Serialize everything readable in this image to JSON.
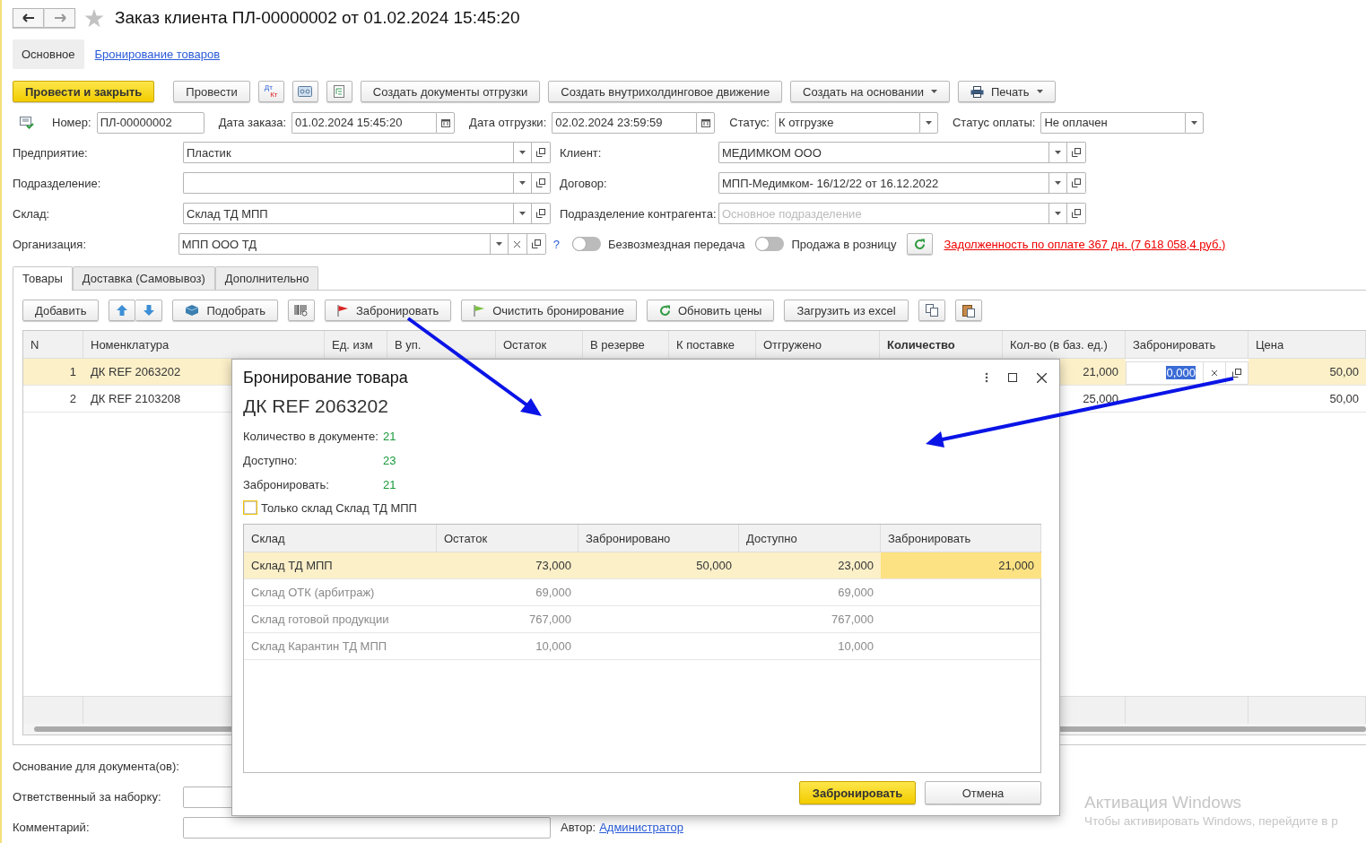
{
  "title": "Заказ клиента ПЛ-00000002 от 01.02.2024 15:45:20",
  "favorite": false,
  "sections": [
    {
      "label": "Основное",
      "selected": true
    },
    {
      "label": "Бронирование товаров",
      "selected": false
    }
  ],
  "commands": [
    {
      "kind": "primary",
      "label": "Провести и закрыть"
    },
    {
      "kind": "button",
      "label": "Провести"
    },
    {
      "kind": "dtkt",
      "top": "Дт",
      "bottom": "Кт"
    },
    {
      "kind": "cassette"
    },
    {
      "kind": "report"
    },
    {
      "kind": "button",
      "label": "Создать документы отгрузки"
    },
    {
      "kind": "button",
      "label": "Создать внутрихолдинговое движение"
    },
    {
      "kind": "menu",
      "label": "Создать на основании"
    },
    {
      "kind": "print",
      "label": "Печать"
    }
  ],
  "header_fields": [
    {
      "kind": "text",
      "label": "Номер:",
      "value": "ПЛ-00000002"
    },
    {
      "kind": "date",
      "label": "Дата заказа:",
      "value": "01.02.2024 15:45:20"
    },
    {
      "kind": "date",
      "label": "Дата отгрузки:",
      "value": "02.02.2024 23:59:59"
    },
    {
      "kind": "select",
      "label": "Статус:",
      "value": "К отгрузке"
    },
    {
      "kind": "select",
      "label": "Статус оплаты:",
      "value": "Не оплачен"
    }
  ],
  "left_fields": [
    {
      "kind": "ref",
      "label": "Предприятие:",
      "value": "Пластик"
    },
    {
      "kind": "ref",
      "label": "Подразделение:"
    },
    {
      "kind": "ref",
      "label": "Склад:",
      "value": "Склад ТД МПП"
    },
    {
      "kind": "clearable",
      "label": "Организация:",
      "value": "МПП ООО ТД"
    }
  ],
  "right_fields": [
    {
      "kind": "ref",
      "label": "Клиент:",
      "value": "МЕДИМКОМ ООО"
    },
    {
      "kind": "ref",
      "label": "Договор:",
      "value": "МПП-Медимком- 16/12/22 от 16.12.2022"
    },
    {
      "kind": "ref",
      "label": "Подразделение контрагента:",
      "placeholder": "Основное подразделение"
    }
  ],
  "help": "?",
  "toggles": [
    {
      "label": "Безвозмездная передача",
      "on": false
    },
    {
      "label": "Продажа в розницу",
      "on": false
    }
  ],
  "debt_link": "Задолженность по оплате 367 дн. (7 618 058,4 руб.)",
  "tabs": [
    {
      "label": "Товары",
      "selected": true
    },
    {
      "label": "Доставка (Самовывоз)",
      "selected": false
    },
    {
      "label": "Дополнительно",
      "selected": false
    }
  ],
  "table_toolbar": [
    {
      "kind": "button",
      "label": "Добавить"
    },
    {
      "kind": "updown"
    },
    {
      "kind": "pick",
      "label": "Подобрать"
    },
    {
      "kind": "barcode"
    },
    {
      "kind": "redflag",
      "label": "Забронировать"
    },
    {
      "kind": "greenflag",
      "label": "Очистить бронирование"
    },
    {
      "kind": "refresh",
      "label": "Обновить цены"
    },
    {
      "kind": "button",
      "label": "Загрузить из excel"
    },
    {
      "kind": "copy"
    },
    {
      "kind": "paste"
    }
  ],
  "table": {
    "columns": [
      {
        "label": "N",
        "emphasized": false
      },
      {
        "label": "Номенклатура",
        "emphasized": false
      },
      {
        "label": "Ед. изм",
        "emphasized": false
      },
      {
        "label": "В уп.",
        "emphasized": false
      },
      {
        "label": "Остаток",
        "emphasized": false
      },
      {
        "label": "В резерве",
        "emphasized": false
      },
      {
        "label": "К поставке",
        "emphasized": false
      },
      {
        "label": "Отгружено",
        "emphasized": false
      },
      {
        "label": "Количество",
        "emphasized": true
      },
      {
        "label": "Кол-во (в баз. ед.)",
        "emphasized": false
      },
      {
        "label": "Забронировать",
        "emphasized": false
      },
      {
        "label": "Цена",
        "emphasized": false
      }
    ],
    "rows": [
      {
        "n": "1",
        "name": "ДК REF 2063202",
        "qty_base": "21,000",
        "reserve": "0,000",
        "price": "50,00",
        "selected": true
      },
      {
        "n": "2",
        "name": "ДК REF 2103208",
        "qty_base": "25,000",
        "price": "50,00",
        "selected": false
      }
    ]
  },
  "bottom": {
    "basis": "Основание для документа(ов):",
    "picker": "Ответственный за наборку:",
    "comment": "Комментарий:",
    "author_label": "Автор:",
    "author": "Администратор"
  },
  "dialog": {
    "title": "Бронирование товара",
    "product": "ДК REF 2063202",
    "info": [
      {
        "label": "Количество в документе:",
        "value": "21"
      },
      {
        "label": "Доступно:",
        "value": "23"
      },
      {
        "label": "Забронировать:",
        "value": "21"
      }
    ],
    "only_warehouse": {
      "label": "Только склад Склад ТД МПП",
      "checked": false
    },
    "columns": [
      "Склад",
      "Остаток",
      "Забронировано",
      "Доступно",
      "Забронировать"
    ],
    "rows": [
      {
        "warehouse": "Склад ТД МПП",
        "stock": "73,000",
        "reserved": "50,000",
        "available": "23,000",
        "to_reserve": "21,000",
        "selected": true,
        "dimmed": false
      },
      {
        "warehouse": "Склад ОТК (арбитраж)",
        "stock": "69,000",
        "available": "69,000",
        "selected": false,
        "dimmed": true
      },
      {
        "warehouse": "Склад готовой продукции",
        "stock": "767,000",
        "available": "767,000",
        "selected": false,
        "dimmed": true
      },
      {
        "warehouse": "Склад Карантин ТД МПП",
        "stock": "10,000",
        "available": "10,000",
        "selected": false,
        "dimmed": true
      }
    ],
    "buttons": [
      {
        "kind": "primary",
        "label": "Забронировать"
      },
      {
        "kind": "default",
        "label": "Отмена"
      }
    ]
  },
  "activation": {
    "title": "Активация Windows",
    "text": "Чтобы активировать Windows, перейдите в р"
  }
}
